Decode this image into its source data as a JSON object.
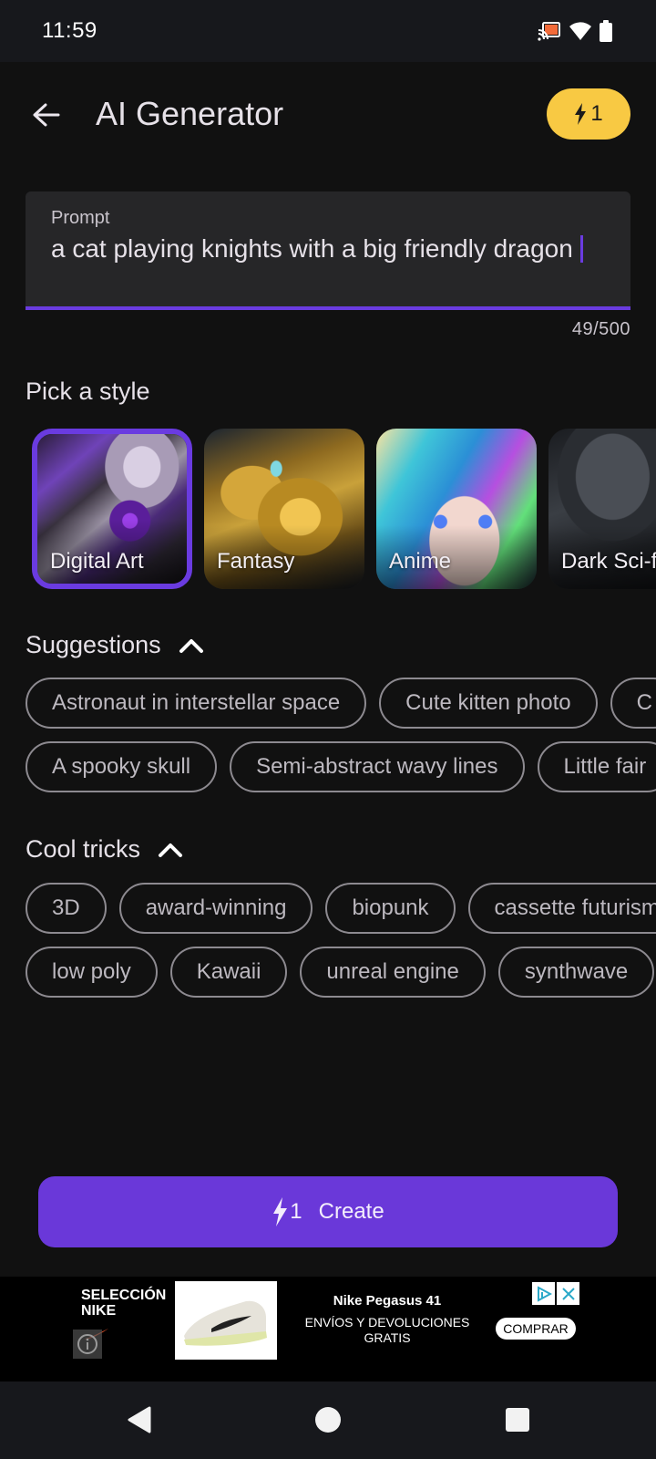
{
  "status_bar": {
    "time": "11:59",
    "icons": [
      "cast-icon",
      "wifi-icon",
      "battery-icon"
    ]
  },
  "header": {
    "back_icon": "arrow-left-icon",
    "title": "AI Generator",
    "credits": {
      "icon": "lightning-icon",
      "count": "1"
    }
  },
  "prompt": {
    "label": "Prompt",
    "value": "a cat playing knights with a big friendly dragon",
    "counter": "49/500"
  },
  "styles": {
    "title": "Pick a style",
    "selected": "Digital Art",
    "items": [
      {
        "label": "Digital Art",
        "selected": true
      },
      {
        "label": "Fantasy",
        "selected": false
      },
      {
        "label": "Anime",
        "selected": false
      },
      {
        "label": "Dark Sci-fi",
        "selected": false
      }
    ]
  },
  "suggestions": {
    "title": "Suggestions",
    "expanded": true,
    "rows": [
      [
        "Astronaut in interstellar space",
        "Cute kitten photo",
        "C"
      ],
      [
        "A spooky skull",
        "Semi-abstract wavy lines",
        "Little fair"
      ]
    ]
  },
  "tricks": {
    "title": "Cool tricks",
    "expanded": true,
    "rows": [
      [
        "3D",
        "award-winning",
        "biopunk",
        "cassette futurism"
      ],
      [
        "low poly",
        "Kawaii",
        "unreal engine",
        "synthwave"
      ]
    ]
  },
  "create_button": {
    "cost": "1",
    "label": "Create"
  },
  "ad": {
    "brand": "SELECCIÓN NIKE",
    "title": "Nike Pegasus 41",
    "subtitle": "ENVÍOS Y DEVOLUCIONES GRATIS",
    "cta": "COMPRAR"
  },
  "colors": {
    "accent": "#6a38d9",
    "credits_badge": "#f8c943",
    "background": "#111111",
    "field": "#262628"
  }
}
